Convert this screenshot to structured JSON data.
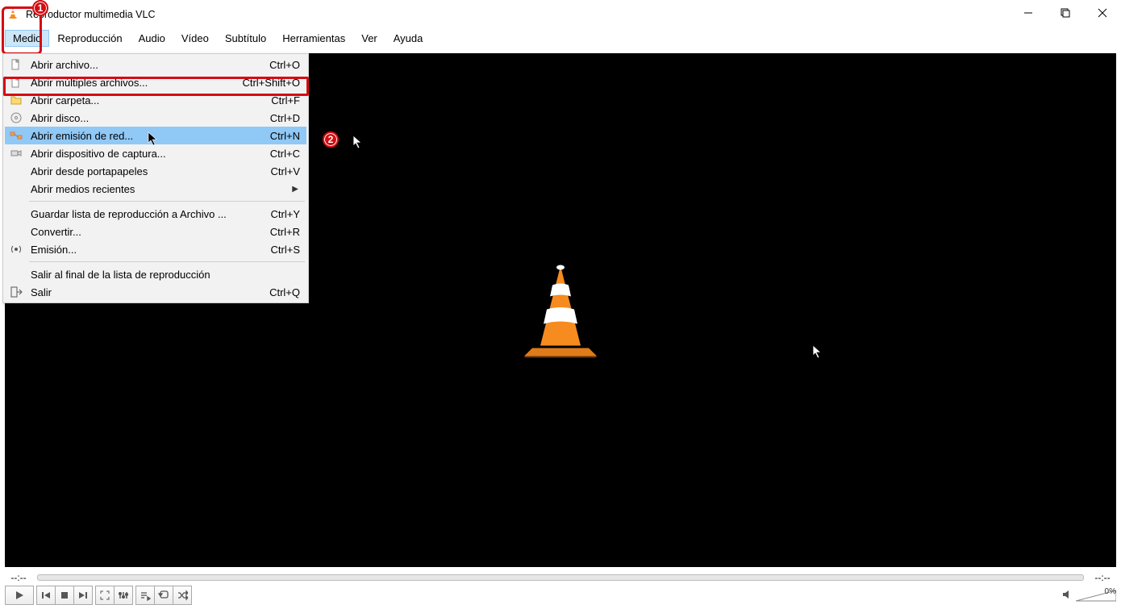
{
  "title": "Reproductor multimedia VLC",
  "menubar": [
    "Medio",
    "Reproducción",
    "Audio",
    "Vídeo",
    "Subtítulo",
    "Herramientas",
    "Ver",
    "Ayuda"
  ],
  "dropdown": {
    "items": [
      {
        "label": "Abrir archivo...",
        "shortcut": "Ctrl+O",
        "icon": "file"
      },
      {
        "label": "Abrir múltiples archivos...",
        "shortcut": "Ctrl+Shift+O",
        "icon": "file"
      },
      {
        "label": "Abrir carpeta...",
        "shortcut": "Ctrl+F",
        "icon": "folder"
      },
      {
        "label": "Abrir disco...",
        "shortcut": "Ctrl+D",
        "icon": "disc"
      },
      {
        "label": "Abrir emisión de red...",
        "shortcut": "Ctrl+N",
        "icon": "net",
        "hl": true
      },
      {
        "label": "Abrir dispositivo de captura...",
        "shortcut": "Ctrl+C",
        "icon": "cam"
      },
      {
        "label": "Abrir desde portapapeles",
        "shortcut": "Ctrl+V"
      },
      {
        "label": "Abrir medios recientes",
        "submenu": true
      },
      {
        "sep": true
      },
      {
        "label": "Guardar lista de reproducción a Archivo ...",
        "shortcut": "Ctrl+Y"
      },
      {
        "label": "Convertir...",
        "shortcut": "Ctrl+R"
      },
      {
        "label": "Emisión...",
        "shortcut": "Ctrl+S",
        "icon": "stream"
      },
      {
        "sep": true
      },
      {
        "label": "Salir al final de la lista de reproducción"
      },
      {
        "label": "Salir",
        "shortcut": "Ctrl+Q",
        "icon": "exit"
      }
    ]
  },
  "time_left": "--:--",
  "time_right": "--:--",
  "volume_pct": "0%",
  "callouts": {
    "one": "1",
    "two": "2"
  }
}
